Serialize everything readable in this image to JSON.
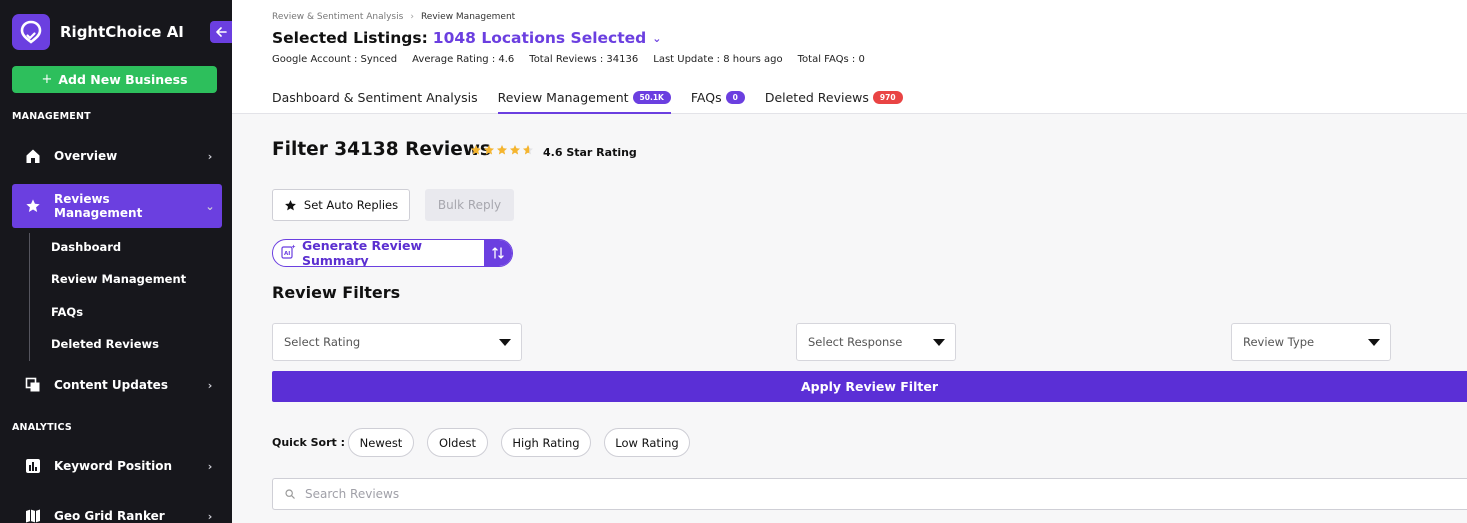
{
  "brand": {
    "name": "RightChoice AI",
    "logo_icon": "location-pin-check-icon",
    "accent": "#6b3fe0"
  },
  "sidebar": {
    "add_button": "Add New Business",
    "section_management": "MANAGEMENT",
    "section_analytics": "ANALYTICS",
    "items": [
      {
        "label": "Overview",
        "icon": "home-icon"
      },
      {
        "label": "Reviews Management",
        "icon": "star-icon",
        "active": true
      },
      {
        "label": "Content Updates",
        "icon": "copy-icon"
      },
      {
        "label": "Keyword Position",
        "icon": "bar-chart-icon"
      },
      {
        "label": "Geo Grid Ranker",
        "icon": "map-icon"
      }
    ],
    "subitems": [
      "Dashboard",
      "Review Management",
      "FAQs",
      "Deleted Reviews"
    ]
  },
  "header": {
    "breadcrumb": [
      "Review & Sentiment Analysis",
      "Review Management"
    ],
    "listing_label": "Selected Listings:",
    "listing_value": "1048 Locations Selected",
    "stats": [
      "Google Account : Synced",
      "Average Rating : 4.6",
      "Total Reviews : 34136",
      "Last Update : 8 hours ago",
      "Total FAQs : 0"
    ],
    "tabs": [
      {
        "label": "Dashboard & Sentiment Analysis",
        "badge": ""
      },
      {
        "label": "Review Management",
        "badge": "50.1K",
        "active": true
      },
      {
        "label": "FAQs",
        "badge": "0"
      },
      {
        "label": "Deleted Reviews",
        "badge": "970"
      }
    ]
  },
  "main": {
    "filter_title": "Filter 34138 Reviews",
    "rating_value": 4.6,
    "rating_label": "4.6 Star Rating",
    "auto_replies_button": "Set Auto Replies",
    "bulk_reply_button": "Bulk Reply",
    "generate_summary_button": "Generate Review Summary",
    "filters_title": "Review Filters",
    "select_rating": "Select Rating",
    "select_response": "Select Response",
    "review_type": "Review Type",
    "apply_button": "Apply Review Filter",
    "quick_sort_label": "Quick Sort :",
    "quick_sort": [
      "Newest",
      "Oldest",
      "High Rating",
      "Low Rating"
    ],
    "search_placeholder": "Search Reviews"
  },
  "colors": {
    "sidebar_bg": "#17171c",
    "accent": "#6b3fe0",
    "success": "#2dbf5c",
    "danger": "#e94444",
    "star": "#f5b52e"
  }
}
